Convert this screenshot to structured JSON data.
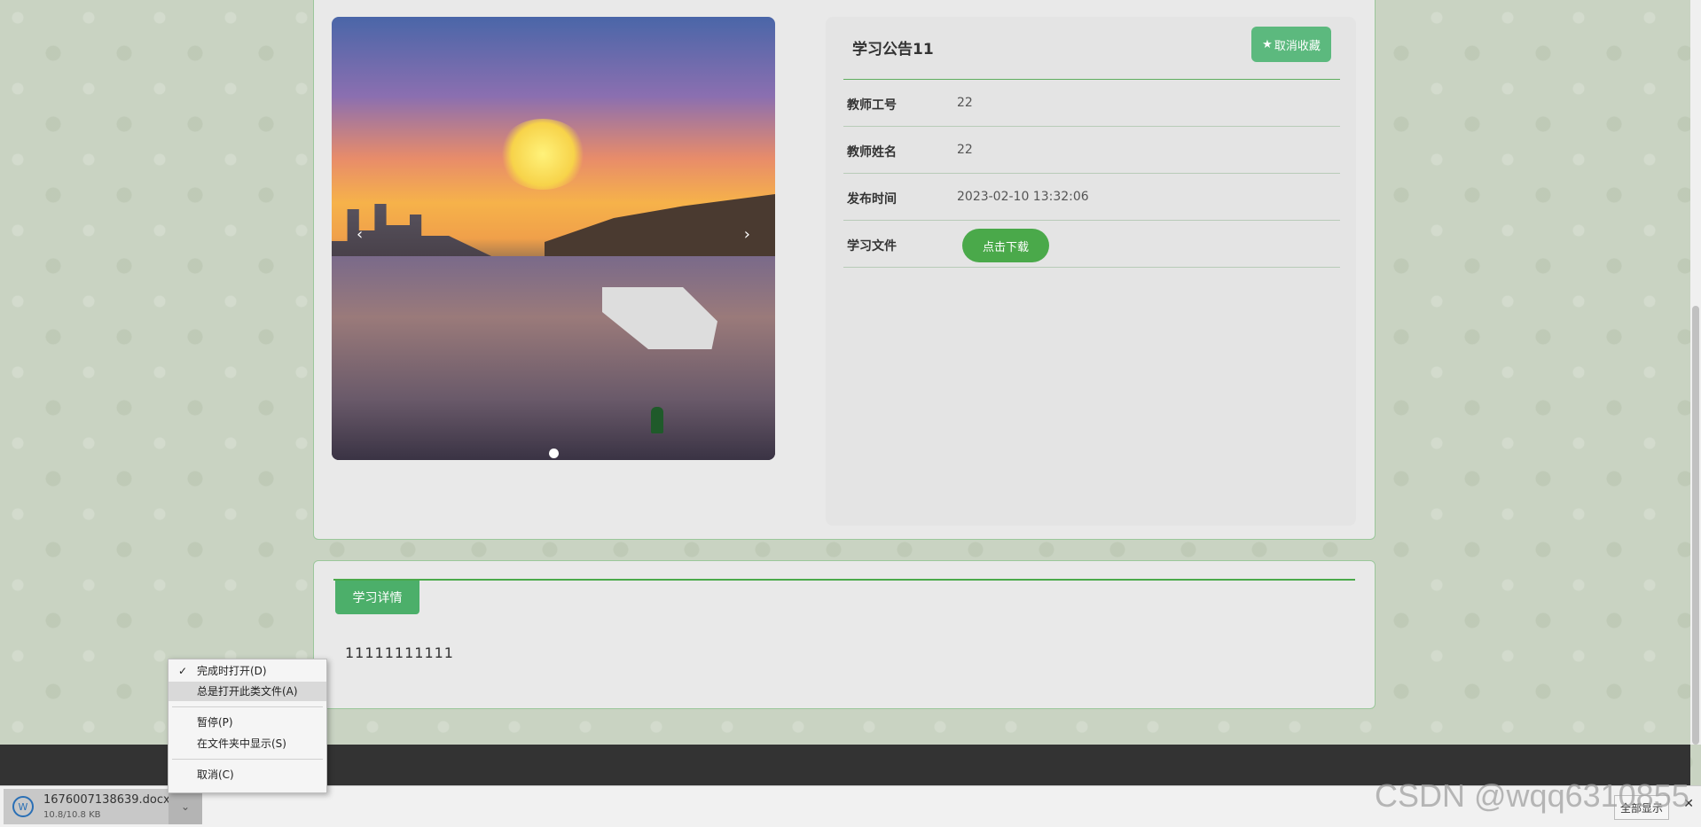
{
  "notice": {
    "title": "学习公告11",
    "unfavorite_label": "取消收藏",
    "fields": [
      {
        "label": "教师工号",
        "value": "22"
      },
      {
        "label": "教师姓名",
        "value": "22"
      },
      {
        "label": "发布时间",
        "value": "2023-02-10 13:32:06"
      },
      {
        "label": "学习文件"
      }
    ],
    "download_label": "点击下载"
  },
  "carousel": {
    "prev": "‹",
    "next": "›"
  },
  "detail": {
    "tab_label": "学习详情",
    "content": "11111111111"
  },
  "download_shelf": {
    "file_name": "1676007138639.docx",
    "file_size": "10.8/10.8 KB",
    "show_all_label": "全部显示",
    "close": "✕"
  },
  "context_menu": {
    "items": [
      {
        "label": "完成时打开(D)",
        "checked": true
      },
      {
        "label": "总是打开此类文件(A)"
      },
      {
        "label": "暂停(P)"
      },
      {
        "label": "在文件夹中显示(S)"
      },
      {
        "label": "取消(C)"
      }
    ]
  },
  "watermark": "CSDN @wqq6310855",
  "colors": {
    "accent": "#4aa94a",
    "favorite_button": "#5cb97e",
    "footer": "#333333"
  }
}
